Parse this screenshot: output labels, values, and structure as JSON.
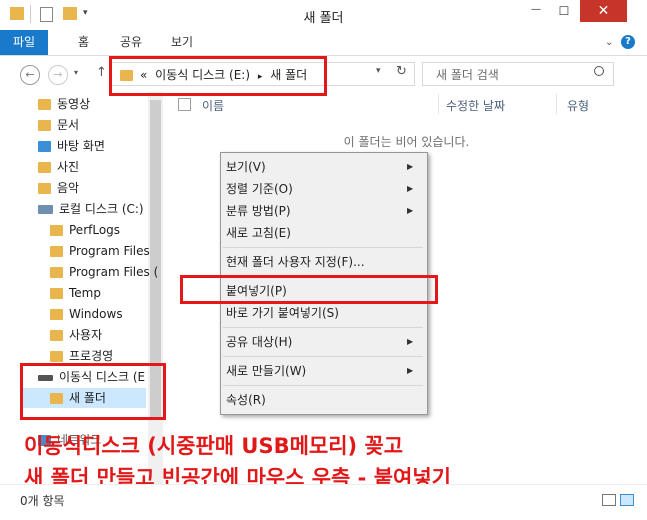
{
  "window": {
    "title": "새 폴더",
    "close_glyph": "✕",
    "min_glyph": "—",
    "max_glyph": "☐"
  },
  "ribbon": {
    "tabs": [
      "파일",
      "홈",
      "공유",
      "보기"
    ]
  },
  "nav": {
    "back": "←",
    "forward": "→",
    "up": "↑",
    "refresh": "↻",
    "dropdown": "▾"
  },
  "address": {
    "prefix": "«",
    "drive": "이동식 디스크 (E:)",
    "separator": "▸",
    "folder": "새 폴더"
  },
  "search": {
    "placeholder": "새 폴더 검색"
  },
  "nav_pane": {
    "items": [
      "동영상",
      "문서",
      "바탕 화면",
      "사진",
      "음악",
      "로컬 디스크 (C:)",
      "PerfLogs",
      "Program Files",
      "Program Files (",
      "Temp",
      "Windows",
      "사용자",
      "프로경영",
      "이동식 디스크 (E",
      "새 폴더",
      "네트워크"
    ]
  },
  "columns": {
    "name": "이름",
    "modified": "수정한 날짜",
    "type": "유형"
  },
  "content": {
    "empty_message": "이 폴더는 비어 있습니다."
  },
  "context_menu": {
    "items": [
      "보기(V)",
      "정렬 기준(O)",
      "분류 방법(P)",
      "새로 고침(E)",
      "현재 폴더 사용자 지정(F)...",
      "붙여넣기(P)",
      "바로 가기 붙여넣기(S)",
      "공유 대상(H)",
      "새로 만들기(W)",
      "속성(R)"
    ],
    "submenu_arrow": "▶"
  },
  "caption": {
    "line1": "이동식디스크 (시중판매 USB메모리) 꽂고",
    "line2": "새 폴더 만들고 빈공간에 마우스 우측 - 붙여넣기"
  },
  "status": {
    "text": "0개 항목"
  },
  "colors": {
    "accent": "#1979ca",
    "annotation_red": "#e41818",
    "close_red": "#c7352a",
    "folder_yellow": "#e8b64c"
  }
}
